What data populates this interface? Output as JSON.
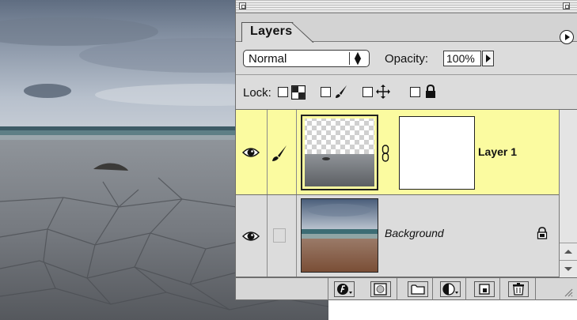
{
  "palette": {
    "tab_label": "Layers",
    "blend_mode": {
      "selected": "Normal"
    },
    "opacity": {
      "label": "Opacity:",
      "value": "100%"
    },
    "lock": {
      "label": "Lock:"
    },
    "layers": [
      {
        "name": "Layer 1",
        "visible": true,
        "selected": true,
        "has_mask": true
      },
      {
        "name": "Background",
        "visible": true,
        "selected": false,
        "locked": true
      }
    ],
    "footer_icons": [
      "layer-style-icon",
      "mask-icon",
      "new-set-icon",
      "adjustment-layer-icon",
      "new-layer-icon",
      "trash-icon"
    ]
  },
  "colors": {
    "selected_row": "#fbfba0",
    "palette_bg": "#dcdcdc"
  }
}
